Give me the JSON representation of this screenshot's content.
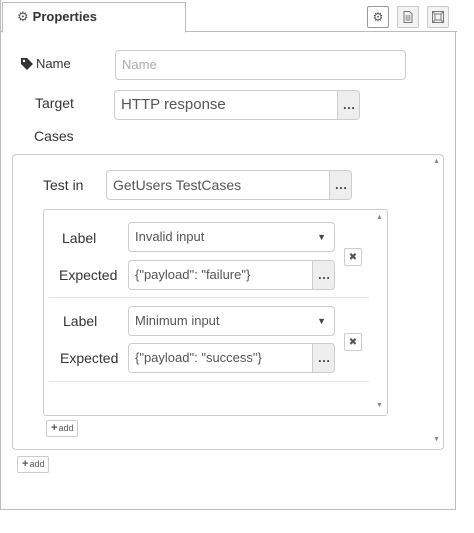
{
  "tabs": {
    "properties": "Properties"
  },
  "icons": {
    "tab": "gear-icon",
    "settings": "gear-icon",
    "description": "document-icon",
    "appearance": "frame-icon"
  },
  "name": {
    "label": "Name",
    "placeholder": "Name",
    "value": ""
  },
  "target": {
    "label": "Target",
    "value": "HTTP response"
  },
  "cases": {
    "label": "Cases",
    "test_in": {
      "label": "Test in",
      "value": "GetUsers TestCases"
    },
    "items": [
      {
        "label_label": "Label",
        "label_value": "Invalid input",
        "expected_label": "Expected",
        "expected_value": "{\"payload\": \"failure\"}"
      },
      {
        "label_label": "Label",
        "label_value": "Minimum input",
        "expected_label": "Expected",
        "expected_value": "{\"payload\": \"success\"}"
      }
    ],
    "inner_add": "add",
    "outer_add": "add"
  },
  "ellipsis": "…",
  "remove": "✖",
  "plus": "+"
}
